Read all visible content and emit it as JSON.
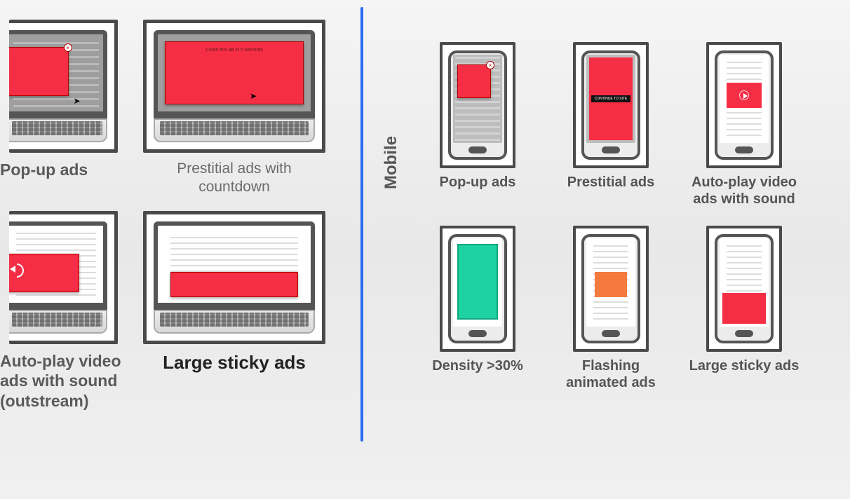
{
  "mobile_section_label": "Mobile",
  "desktop": {
    "items": [
      {
        "label": "Pop-up ads"
      },
      {
        "label": "Prestitial ads with countdown",
        "countdown_text": "Close this ad in 5 seconds"
      },
      {
        "label": "Auto-play video ads with sound (outstream)"
      },
      {
        "label": "Large sticky ads"
      }
    ]
  },
  "mobile": {
    "items": [
      {
        "label": "Pop-up ads"
      },
      {
        "label": "Prestitial ads",
        "bar_text": "CONTINUE TO SITE"
      },
      {
        "label": "Auto-play video ads with sound"
      },
      {
        "label": "Density >30%"
      },
      {
        "label": "Flashing animated ads"
      },
      {
        "label": "Large sticky ads"
      }
    ]
  }
}
